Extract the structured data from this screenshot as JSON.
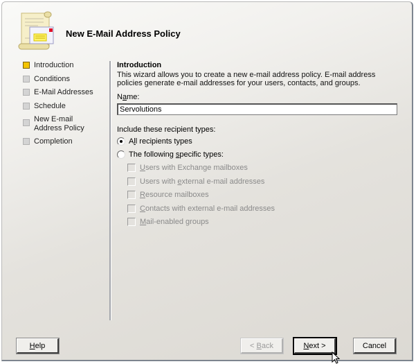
{
  "wizard": {
    "title": "New E-Mail Address Policy",
    "icon": "email-policy-scroll-icon"
  },
  "steps": [
    {
      "label": "Introduction",
      "active": true
    },
    {
      "label": "Conditions",
      "active": false
    },
    {
      "label": "E-Mail Addresses",
      "active": false
    },
    {
      "label": "Schedule",
      "active": false
    },
    {
      "label": "New E-mail Address Policy",
      "active": false
    },
    {
      "label": "Completion",
      "active": false
    }
  ],
  "content": {
    "section_title": "Introduction",
    "description": "This wizard allows you to create a new e-mail address policy. E-mail address policies generate e-mail addresses for your users, contacts, and groups.",
    "name_label_pre": "N",
    "name_label_u": "a",
    "name_label_post": "me:",
    "name_value": "Servolutions",
    "include_label": "Include these recipient types:",
    "radios": [
      {
        "pre": "A",
        "u": "l",
        "post": "l recipients types",
        "checked": true
      },
      {
        "pre": "The following ",
        "u": "s",
        "post": "pecific types:",
        "checked": false
      }
    ],
    "checkboxes": [
      {
        "pre": "",
        "u": "U",
        "post": "sers with Exchange mailboxes",
        "checked": false,
        "enabled": false
      },
      {
        "pre": "Users with ",
        "u": "e",
        "post": "xternal e-mail addresses",
        "checked": false,
        "enabled": false
      },
      {
        "pre": "",
        "u": "R",
        "post": "esource mailboxes",
        "checked": false,
        "enabled": false
      },
      {
        "pre": "",
        "u": "C",
        "post": "ontacts with external e-mail addresses",
        "checked": false,
        "enabled": false
      },
      {
        "pre": "",
        "u": "M",
        "post": "ail-enabled groups",
        "checked": false,
        "enabled": false
      }
    ]
  },
  "buttons": {
    "help": {
      "pre": "",
      "u": "H",
      "post": "elp"
    },
    "back": {
      "pre": "< ",
      "u": "B",
      "post": "ack",
      "enabled": false
    },
    "next": {
      "pre": "",
      "u": "N",
      "post": "ext >",
      "enabled": true
    },
    "cancel": {
      "label": "Cancel"
    }
  }
}
